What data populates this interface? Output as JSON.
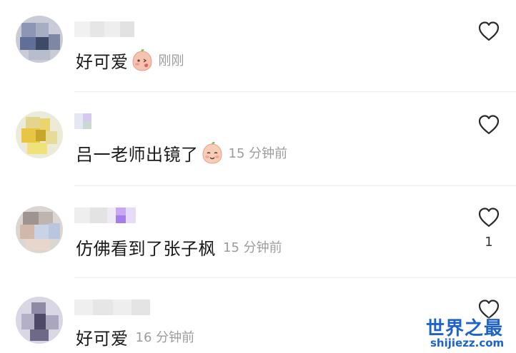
{
  "comments": [
    {
      "text": "好可爱",
      "has_emoji": true,
      "emoji_name": "blushing-peach-emoji",
      "time": "刚刚",
      "like_count": ""
    },
    {
      "text": "吕一老师出镜了",
      "has_emoji": true,
      "emoji_name": "smiling-peach-emoji",
      "time": "15 分钟前",
      "like_count": ""
    },
    {
      "text": "仿佛看到了张子枫",
      "has_emoji": false,
      "time": "15 分钟前",
      "like_count": "1"
    },
    {
      "text": "好可爱",
      "has_emoji": false,
      "time": "16 分钟前",
      "like_count": ""
    }
  ],
  "icons": {
    "like": "heart-outline-icon"
  },
  "watermark": {
    "title": "世界之最",
    "url": "shijiezz.com"
  },
  "colors": {
    "text": "#1a1a1a",
    "time": "#9c9c9c",
    "divider": "#ececec",
    "watermark": "#1e63c9"
  }
}
